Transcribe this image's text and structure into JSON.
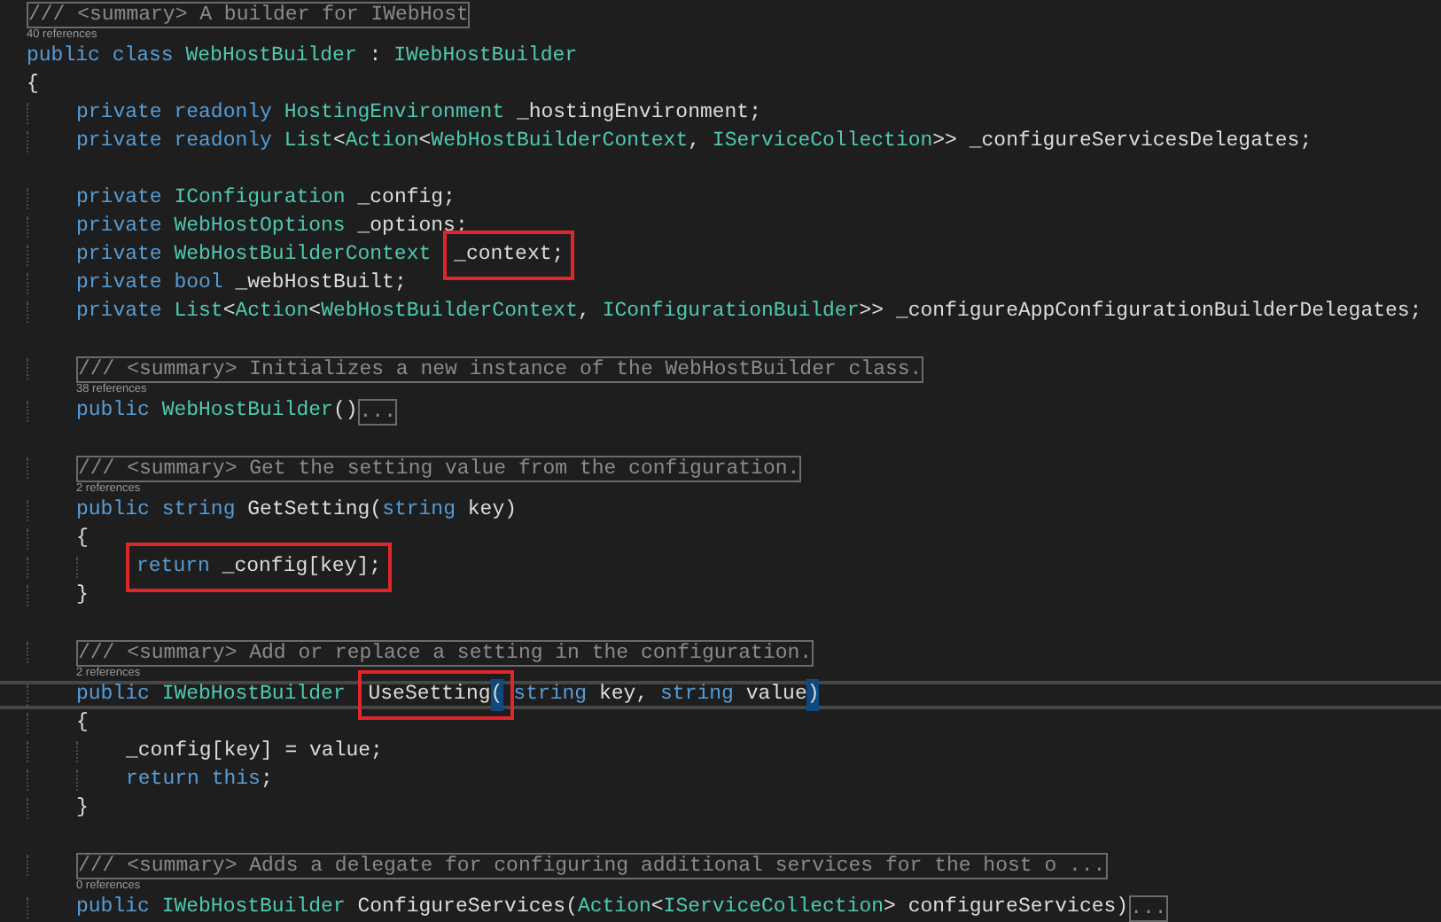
{
  "editor": {
    "lines": [
      {
        "kind": "code",
        "current": false,
        "tokens": [
          {
            "kind": "comment",
            "text": "/// <summary> A builder for IWebHost"
          }
        ]
      },
      {
        "kind": "lens",
        "text": "40 references"
      },
      {
        "kind": "code",
        "current": false,
        "tokens": [
          {
            "kind": "keyword",
            "text": "public"
          },
          {
            "kind": "keyword",
            "text": " class"
          },
          {
            "kind": "type",
            "text": " WebHostBuilder"
          },
          {
            "kind": "plain",
            "text": " : "
          },
          {
            "kind": "type",
            "text": "IWebHostBuilder"
          }
        ]
      },
      {
        "kind": "code",
        "current": false,
        "tokens": [
          {
            "kind": "plain",
            "text": "{"
          }
        ],
        "children": [
          {
            "kind": "code",
            "current": false,
            "tokens": [
              {
                "kind": "keyword",
                "text": "private readonly"
              },
              {
                "kind": "type",
                "text": " HostingEnvironment"
              },
              {
                "kind": "plain",
                "text": " _hostingEnvironment;"
              }
            ]
          },
          {
            "kind": "code",
            "current": false,
            "tokens": [
              {
                "kind": "keyword",
                "text": "private readonly"
              },
              {
                "kind": "type",
                "text": " List"
              },
              {
                "kind": "plain",
                "text": "<"
              },
              {
                "kind": "type",
                "text": "Action"
              },
              {
                "kind": "plain",
                "text": "<"
              },
              {
                "kind": "type",
                "text": "WebHostBuilderContext"
              },
              {
                "kind": "plain",
                "text": ", "
              },
              {
                "kind": "type",
                "text": "IServiceCollection"
              },
              {
                "kind": "plain",
                "text": ">> _configureServicesDelegates;"
              }
            ]
          },
          {
            "kind": "blank"
          },
          {
            "kind": "code",
            "current": false,
            "tokens": [
              {
                "kind": "keyword",
                "text": "private"
              },
              {
                "kind": "type",
                "text": " IConfiguration"
              },
              {
                "kind": "plain",
                "text": " _config;"
              }
            ]
          },
          {
            "kind": "code",
            "current": false,
            "tokens": [
              {
                "kind": "keyword",
                "text": "private"
              },
              {
                "kind": "type",
                "text": " WebHostOptions"
              },
              {
                "kind": "plain",
                "text": " _options;"
              }
            ]
          },
          {
            "kind": "code",
            "current": false,
            "tokens": [
              {
                "kind": "keyword",
                "text": "private"
              },
              {
                "kind": "type",
                "text": " WebHostBuilderContext "
              },
              {
                "kind": "annotation",
                "tokens": [
                  {
                    "kind": "plain",
                    "text": "_context;"
                  }
                ]
              }
            ]
          },
          {
            "kind": "code",
            "current": false,
            "tokens": [
              {
                "kind": "keyword",
                "text": "private"
              },
              {
                "kind": "keyword",
                "text": " bool"
              },
              {
                "kind": "plain",
                "text": " _webHostBuilt;"
              }
            ]
          },
          {
            "kind": "code",
            "current": false,
            "tokens": [
              {
                "kind": "keyword",
                "text": "private"
              },
              {
                "kind": "type",
                "text": " List"
              },
              {
                "kind": "plain",
                "text": "<"
              },
              {
                "kind": "type",
                "text": "Action"
              },
              {
                "kind": "plain",
                "text": "<"
              },
              {
                "kind": "type",
                "text": "WebHostBuilderContext"
              },
              {
                "kind": "plain",
                "text": ", "
              },
              {
                "kind": "type",
                "text": "IConfigurationBuilder"
              },
              {
                "kind": "plain",
                "text": ">> _configureAppConfigurationBuilderDelegates;"
              }
            ]
          },
          {
            "kind": "blank"
          },
          {
            "kind": "code",
            "current": false,
            "tokens": [
              {
                "kind": "comment",
                "text": "/// <summary> Initializes a new instance of the WebHostBuilder class."
              }
            ]
          },
          {
            "kind": "lens",
            "text": "38 references"
          },
          {
            "kind": "code",
            "current": false,
            "tokens": [
              {
                "kind": "keyword",
                "text": "public"
              },
              {
                "kind": "type",
                "text": " WebHostBuilder"
              },
              {
                "kind": "plain",
                "text": "()"
              },
              {
                "kind": "collapsed",
                "text": "..."
              }
            ]
          },
          {
            "kind": "blank"
          },
          {
            "kind": "code",
            "current": false,
            "tokens": [
              {
                "kind": "comment",
                "text": "/// <summary> Get the setting value from the configuration."
              }
            ]
          },
          {
            "kind": "lens",
            "text": "2 references"
          },
          {
            "kind": "code",
            "current": false,
            "tokens": [
              {
                "kind": "keyword",
                "text": "public"
              },
              {
                "kind": "keyword",
                "text": " string"
              },
              {
                "kind": "plain",
                "text": " GetSetting("
              },
              {
                "kind": "keyword",
                "text": "string"
              },
              {
                "kind": "plain",
                "text": " key)"
              }
            ]
          },
          {
            "kind": "code",
            "current": false,
            "tokens": [
              {
                "kind": "plain",
                "text": "{"
              }
            ],
            "children": [
              {
                "kind": "code",
                "current": false,
                "tokens": [
                  {
                    "kind": "annotation",
                    "tokens": [
                      {
                        "kind": "keyword",
                        "text": "return"
                      },
                      {
                        "kind": "plain",
                        "text": " _config[key];"
                      }
                    ]
                  }
                ]
              }
            ]
          },
          {
            "kind": "code",
            "current": false,
            "tokens": [
              {
                "kind": "plain",
                "text": "}"
              }
            ]
          },
          {
            "kind": "blank"
          },
          {
            "kind": "code",
            "current": false,
            "tokens": [
              {
                "kind": "comment",
                "text": "/// <summary> Add or replace a setting in the configuration."
              }
            ]
          },
          {
            "kind": "lens",
            "text": "2 references"
          },
          {
            "kind": "code",
            "current": true,
            "tokens": [
              {
                "kind": "keyword",
                "text": "public"
              },
              {
                "kind": "type",
                "text": " IWebHostBuilder "
              },
              {
                "kind": "annotation",
                "tokens": [
                  {
                    "kind": "plain",
                    "text": "UseSetting"
                  },
                  {
                    "kind": "bracket",
                    "text": "("
                  }
                ]
              },
              {
                "kind": "keyword",
                "text": "string"
              },
              {
                "kind": "plain",
                "text": " key, "
              },
              {
                "kind": "keyword",
                "text": "string"
              },
              {
                "kind": "plain",
                "text": " value"
              },
              {
                "kind": "bracket",
                "text": ")"
              }
            ]
          },
          {
            "kind": "code",
            "current": false,
            "tokens": [
              {
                "kind": "plain",
                "text": "{"
              }
            ],
            "children": [
              {
                "kind": "code",
                "current": false,
                "tokens": [
                  {
                    "kind": "plain",
                    "text": "_config[key] = value;"
                  }
                ]
              },
              {
                "kind": "code",
                "current": false,
                "tokens": [
                  {
                    "kind": "keyword",
                    "text": "return"
                  },
                  {
                    "kind": "keyword",
                    "text": " this"
                  },
                  {
                    "kind": "plain",
                    "text": ";"
                  }
                ]
              }
            ]
          },
          {
            "kind": "code",
            "current": false,
            "tokens": [
              {
                "kind": "plain",
                "text": "}"
              }
            ]
          },
          {
            "kind": "blank"
          },
          {
            "kind": "code",
            "current": false,
            "tokens": [
              {
                "kind": "comment",
                "text": "/// <summary> Adds a delegate for configuring additional services for the host o ..."
              }
            ]
          },
          {
            "kind": "lens",
            "text": "0 references"
          },
          {
            "kind": "code",
            "current": false,
            "tokens": [
              {
                "kind": "keyword",
                "text": "public"
              },
              {
                "kind": "type",
                "text": " IWebHostBuilder"
              },
              {
                "kind": "plain",
                "text": " ConfigureServices("
              },
              {
                "kind": "type",
                "text": "Action"
              },
              {
                "kind": "plain",
                "text": "<"
              },
              {
                "kind": "type",
                "text": "IServiceCollection"
              },
              {
                "kind": "plain",
                "text": "> configureServices)"
              },
              {
                "kind": "collapsed",
                "text": "..."
              }
            ]
          }
        ]
      }
    ]
  }
}
